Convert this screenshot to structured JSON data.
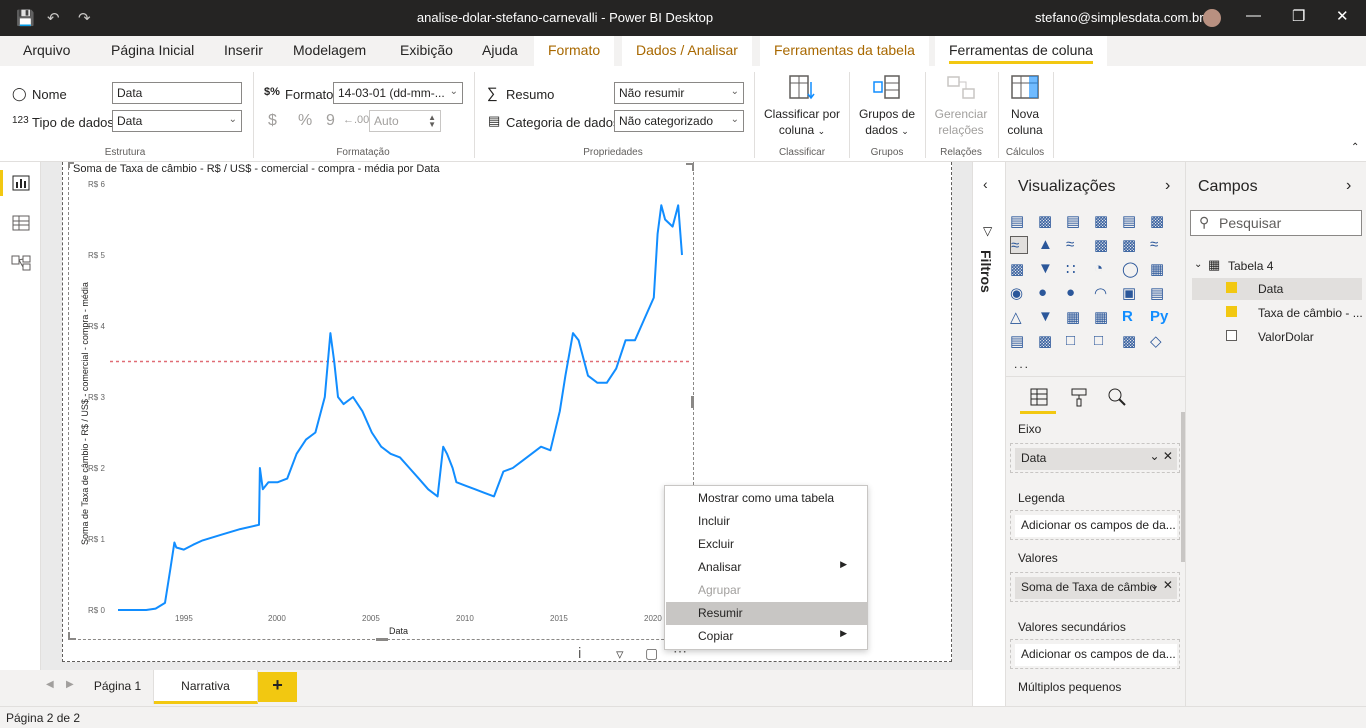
{
  "window": {
    "title": "analise-dolar-stefano-carnevalli - Power BI Desktop",
    "user": "stefano@simplesdata.com.br"
  },
  "tabs": [
    "Arquivo",
    "Página Inicial",
    "Inserir",
    "Modelagem",
    "Exibição",
    "Ajuda",
    "Formato",
    "Dados / Analisar",
    "Ferramentas da tabela",
    "Ferramentas de coluna"
  ],
  "ribbon": {
    "estrutura": {
      "name_label": "Nome",
      "name_value": "Data",
      "type_label": "Tipo de dados",
      "type_value": "Data",
      "group": "Estrutura"
    },
    "formatacao": {
      "format_label": "Formato",
      "format_value": "14-03-01 (dd-mm-...",
      "auto_value": "Auto",
      "group": "Formatação",
      "currency": "$",
      "percent": "%",
      "comma": "9"
    },
    "propriedades": {
      "summary_label": "Resumo",
      "summary_value": "Não resumir",
      "category_label": "Categoria de dados",
      "category_value": "Não categorizado",
      "group": "Propriedades"
    },
    "classificar": {
      "button_line1": "Classificar por",
      "button_line2": "coluna",
      "group": "Classificar"
    },
    "grupos": {
      "button_line1": "Grupos de",
      "button_line2": "dados",
      "group": "Grupos"
    },
    "relacoes": {
      "button_line1": "Gerenciar",
      "button_line2": "relações",
      "group": "Relações"
    },
    "calculos": {
      "button_line1": "Nova",
      "button_line2": "coluna",
      "group": "Cálculos"
    }
  },
  "visual": {
    "title": "Soma de Taxa de câmbio - R$ / US$ - comercial - compra - média por Data",
    "ylabel": "Soma de Taxa de câmbio - R$ / US$ - comercial - compra - média",
    "xlabel": "Data",
    "yticks": [
      "R$ 6",
      "R$ 5",
      "R$ 4",
      "R$ 3",
      "R$ 2",
      "R$ 1",
      "R$ 0"
    ],
    "xticks": [
      "1995",
      "2000",
      "2005",
      "2010",
      "2015",
      "2020"
    ]
  },
  "chart_data": {
    "type": "line",
    "title": "Soma de Taxa de câmbio - R$ / US$ - comercial - compra - média por Data",
    "xlabel": "Data",
    "ylabel": "Soma de Taxa de câmbio - R$ / US$ - comercial - compra - média",
    "ylim": [
      0,
      6
    ],
    "xlim": [
      1991.5,
      2021.5
    ],
    "grid": false,
    "average_line": 3.5,
    "series": [
      {
        "color": "#118dff",
        "x": [
          1991.5,
          1993.0,
          1993.5,
          1994.0,
          1994.3,
          1994.5,
          1994.6,
          1995.0,
          1995.5,
          1996.0,
          1997.0,
          1998.0,
          1999.0,
          1999.05,
          1999.2,
          1999.5,
          2000.0,
          2000.5,
          2001.0,
          2001.5,
          2002.0,
          2002.5,
          2002.8,
          2003.0,
          2003.2,
          2003.5,
          2004.0,
          2004.5,
          2005.0,
          2005.5,
          2006.0,
          2006.5,
          2007.0,
          2007.5,
          2008.0,
          2008.5,
          2008.8,
          2009.0,
          2009.3,
          2009.5,
          2010.0,
          2010.5,
          2011.0,
          2011.5,
          2012.0,
          2012.5,
          2013.0,
          2013.5,
          2014.0,
          2014.5,
          2015.0,
          2015.3,
          2015.7,
          2016.0,
          2016.5,
          2017.0,
          2017.5,
          2018.0,
          2018.5,
          2019.0,
          2019.5,
          2020.0,
          2020.2,
          2020.4,
          2020.6,
          2021.0,
          2021.3,
          2021.5
        ],
        "y": [
          0.0,
          0.0,
          0.02,
          0.1,
          0.6,
          0.95,
          0.88,
          0.85,
          0.92,
          0.98,
          1.06,
          1.14,
          1.2,
          2.0,
          1.7,
          1.8,
          1.8,
          1.85,
          2.2,
          2.4,
          2.5,
          3.0,
          3.9,
          3.5,
          3.0,
          2.9,
          3.0,
          2.8,
          2.5,
          2.3,
          2.2,
          2.15,
          2.0,
          1.85,
          1.7,
          1.6,
          2.3,
          2.2,
          2.0,
          1.8,
          1.75,
          1.7,
          1.65,
          1.6,
          1.95,
          2.0,
          2.1,
          2.2,
          2.3,
          2.25,
          2.8,
          3.3,
          3.9,
          3.8,
          3.3,
          3.2,
          3.2,
          3.4,
          3.8,
          3.8,
          4.1,
          4.4,
          5.3,
          5.7,
          5.5,
          5.4,
          5.7,
          5.0
        ]
      }
    ]
  },
  "context_menu": {
    "items": [
      {
        "label": "Mostrar como uma tabela"
      },
      {
        "label": "Incluir"
      },
      {
        "label": "Excluir"
      },
      {
        "label": "Analisar",
        "submenu": true
      },
      {
        "label": "Agrupar",
        "disabled": true
      },
      {
        "label": "Resumir",
        "highlighted": true
      },
      {
        "label": "Copiar",
        "submenu": true
      }
    ]
  },
  "page_tabs": [
    "Página 1",
    "Narrativa"
  ],
  "status": "Página 2 de 2",
  "filters_label": "Filtros",
  "visualizations": {
    "title": "Visualizações",
    "more": "...",
    "wells": {
      "eixo": {
        "label": "Eixo",
        "value": "Data"
      },
      "legenda": {
        "label": "Legenda",
        "placeholder": "Adicionar os campos de da..."
      },
      "valores": {
        "label": "Valores",
        "value": "Soma de Taxa de câmbio"
      },
      "secundarios": {
        "label": "Valores secundários",
        "placeholder": "Adicionar os campos de da..."
      },
      "multiplos": {
        "label": "Múltiplos pequenos"
      }
    }
  },
  "fields": {
    "title": "Campos",
    "search_placeholder": "Pesquisar",
    "table": "Tabela 4",
    "items": [
      {
        "label": "Data",
        "checked": true
      },
      {
        "label": "Taxa de câmbio - ...",
        "checked": true
      },
      {
        "label": "ValorDolar",
        "checked": false
      }
    ]
  },
  "colors": {
    "accent": "#f2c811",
    "line": "#118dff",
    "avg": "#e06c75"
  }
}
